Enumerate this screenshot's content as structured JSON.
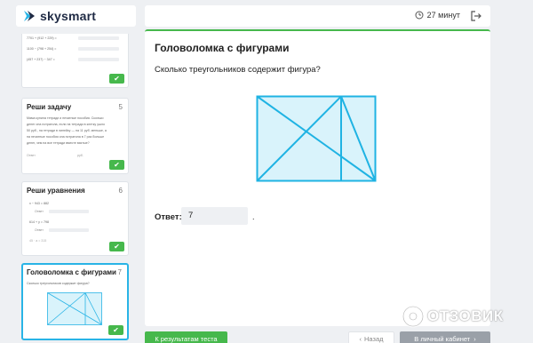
{
  "brand": {
    "name": "skysmart",
    "accent": "#29b4e6",
    "green": "#46b84c"
  },
  "topbar": {
    "timer": "27 минут",
    "clock_icon": "clock-icon",
    "exit_icon": "exit-icon"
  },
  "task": {
    "title": "Головоломка с фигурами",
    "question": "Сколько треугольников содержит фигура?",
    "answer_label": "Ответ:",
    "answer_value": "7",
    "answer_suffix": "."
  },
  "sidebar": {
    "card1": {
      "lines": [
        "7701 + (912 + 229) =",
        "1100 − (798 + 254) =",
        "(457 + 237) − 347 ="
      ]
    },
    "card2": {
      "title": "Реши задачу",
      "num": "5",
      "text": [
        "Мама купила тетради и печатные пособия. Сколько",
        "денег она потратила, если на тетради в клетку ушло",
        "50 руб., на тетради в линейку — на 11 руб. меньше, а",
        "на печатные пособия она потратила в 7 раз больше",
        "денег, чем на все тетради вместе взятые?"
      ],
      "answer_label": "Ответ",
      "answer_unit": "руб."
    },
    "card3": {
      "title": "Реши уравнения",
      "num": "6",
      "lines": [
        "x − 943 = 882",
        "614 + y = 798",
        "45 · a = 315"
      ],
      "answer_label": "Ответ"
    },
    "card4": {
      "title": "Головоломка с фигурами",
      "num": "7",
      "question": "Сколько треугольников содержит фигура?"
    }
  },
  "footer": {
    "results_button": "К результатам теста",
    "back_button": "Назад",
    "cabinet_button": "В личный кабинет"
  },
  "watermark": {
    "text": "ОТЗОВИК"
  }
}
